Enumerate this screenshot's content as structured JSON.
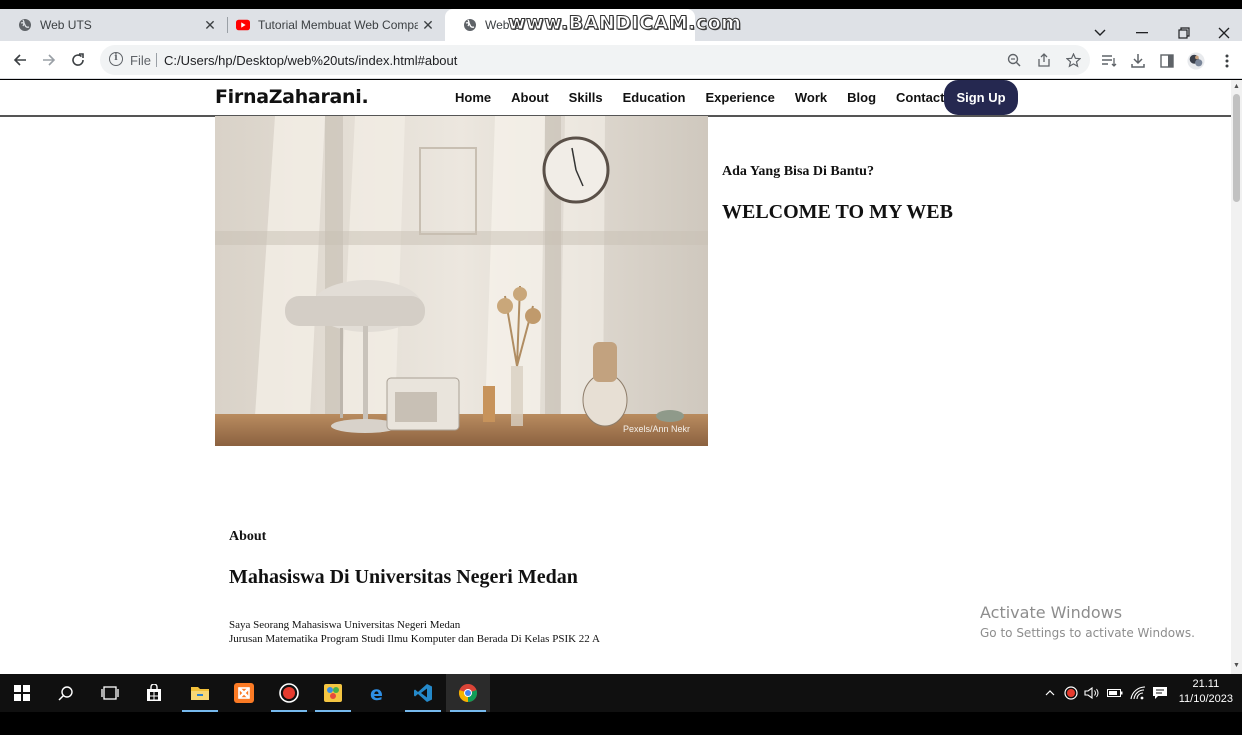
{
  "browser": {
    "tabs": [
      {
        "title": "Web UTS",
        "active": false
      },
      {
        "title": "Tutorial Membuat Web Compan",
        "active": false
      },
      {
        "title": "Web U",
        "active": true
      }
    ],
    "address": {
      "scheme_label": "File",
      "url": "C:/Users/hp/Desktop/web%20uts/index.html#about"
    }
  },
  "watermark": "www.BANDICAM.com",
  "site": {
    "logo": "FirnaZaharani.",
    "nav": [
      "Home",
      "About",
      "Skills",
      "Education",
      "Experience",
      "Work",
      "Blog",
      "Contact"
    ],
    "signup": "Sign Up",
    "hero": {
      "image_credit": "Pexels/Ann Nekr",
      "subtitle": "Ada Yang Bisa Di Bantu?",
      "title": "WELCOME TO MY WEB"
    },
    "about": {
      "label": "About",
      "title": "Mahasiswa Di Universitas Negeri Medan",
      "line1": "Saya Seorang Mahasiswa Universitas Negeri Medan",
      "line2": "Jurusan Matematika Program Studi Ilmu Komputer dan Berada Di Kelas PSIK 22 A"
    }
  },
  "activation": {
    "title": "Activate Windows",
    "subtitle": "Go to Settings to activate Windows."
  },
  "taskbar": {
    "time": "21.11",
    "date": "11/10/2023"
  },
  "colors": {
    "signup_bg": "#252850",
    "taskbar_bg": "#101010",
    "tabstrip_bg": "#dee1e6"
  }
}
